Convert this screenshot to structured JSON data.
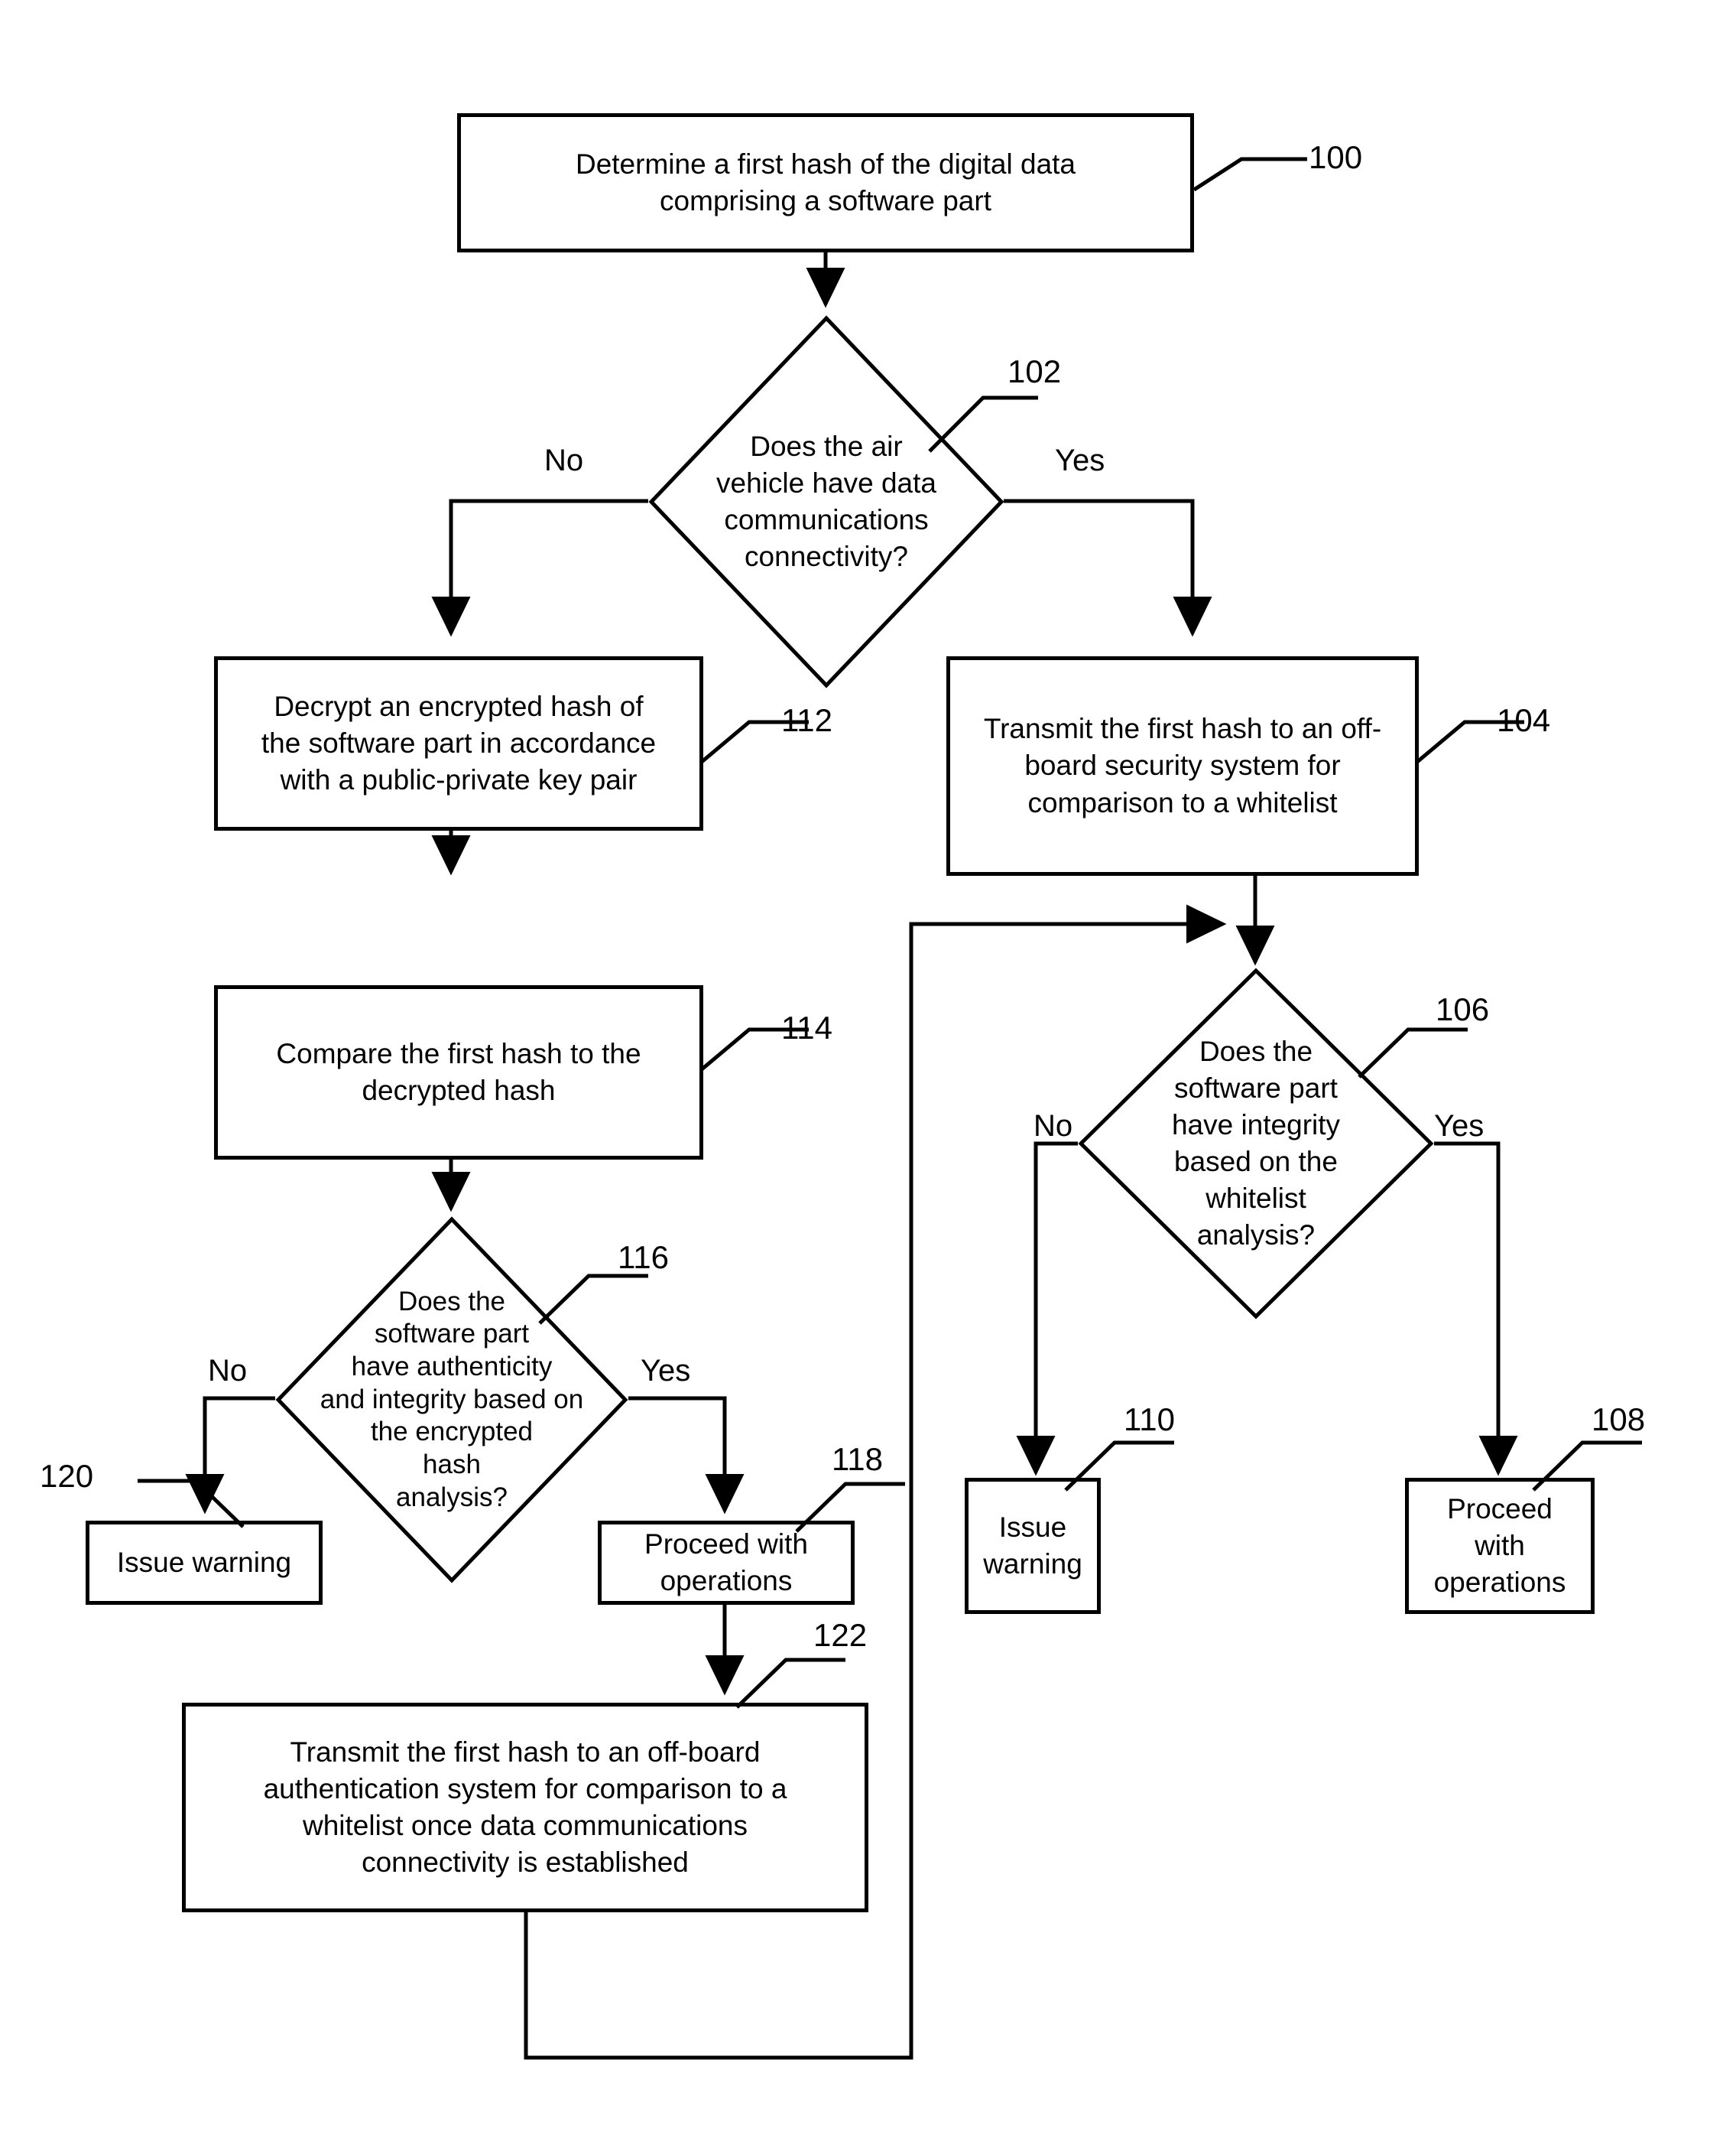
{
  "figure": {
    "type": "flowchart",
    "title": "",
    "nodes": [
      {
        "ref": "100",
        "shape": "process",
        "text": "Determine a first hash of the digital data comprising a software part",
        "lines": [
          "Determine a first hash of the digital data",
          "comprising a software part"
        ]
      },
      {
        "ref": "102",
        "shape": "decision",
        "text": "Does the air vehicle have data communications connectivity?",
        "lines": [
          "Does the air",
          "vehicle have data",
          "communications",
          "connectivity?"
        ],
        "branches": [
          "No",
          "Yes"
        ]
      },
      {
        "ref": "104",
        "shape": "process",
        "text": "Transmit the first hash to an off-board security system for comparison to a whitelist",
        "lines": [
          "Transmit the first hash to an off-",
          "board security system for",
          "comparison to a whitelist"
        ]
      },
      {
        "ref": "106",
        "shape": "decision",
        "text": "Does the software part have integrity based on the whitelist analysis?",
        "lines": [
          "Does the",
          "software part",
          "have integrity",
          "based on the",
          "whitelist",
          "analysis?"
        ],
        "branches": [
          "No",
          "Yes"
        ]
      },
      {
        "ref": "108",
        "shape": "process",
        "text": "Proceed with operations",
        "lines": [
          "Proceed",
          "with",
          "operations"
        ]
      },
      {
        "ref": "110",
        "shape": "process",
        "text": "Issue warning",
        "lines": [
          "Issue",
          "warning"
        ]
      },
      {
        "ref": "112",
        "shape": "process",
        "text": "Decrypt an encrypted hash of the software part in accordance with a public-private key pair",
        "lines": [
          "Decrypt an encrypted hash of",
          "the software part in accordance",
          "with a public-private key pair"
        ]
      },
      {
        "ref": "114",
        "shape": "process",
        "text": "Compare the first hash to the decrypted hash",
        "lines": [
          "Compare the first hash to the",
          "decrypted hash"
        ]
      },
      {
        "ref": "116",
        "shape": "decision",
        "text": "Does the software part have authenticity and integrity based on the encrypted hash analysis?",
        "lines": [
          "Does the",
          "software part",
          "have authenticity",
          "and integrity based on",
          "the encrypted",
          "hash",
          "analysis?"
        ],
        "branches": [
          "No",
          "Yes"
        ]
      },
      {
        "ref": "118",
        "shape": "process",
        "text": "Proceed with operations",
        "lines": [
          "Proceed with",
          "operations"
        ]
      },
      {
        "ref": "120",
        "shape": "process",
        "text": "Issue warning",
        "lines": [
          "Issue warning"
        ]
      },
      {
        "ref": "122",
        "shape": "process",
        "text": "Transmit the first hash to an off-board authentication system for comparison to a whitelist once data communications connectivity is established",
        "lines": [
          "Transmit the first hash to an off-board",
          "authentication system for comparison to a",
          "whitelist once data communications",
          "connectivity is established"
        ]
      }
    ],
    "edge_labels": {
      "d102_no": "No",
      "d102_yes": "Yes",
      "d106_no": "No",
      "d106_yes": "Yes",
      "d116_no": "No",
      "d116_yes": "Yes"
    },
    "ref_labels": {
      "r100": "100",
      "r102": "102",
      "r104": "104",
      "r106": "106",
      "r108": "108",
      "r110": "110",
      "r112": "112",
      "r114": "114",
      "r116": "116",
      "r118": "118",
      "r120": "120",
      "r122": "122"
    },
    "colors": {
      "stroke": "#000000",
      "fill": "#ffffff",
      "text": "#000000"
    }
  }
}
